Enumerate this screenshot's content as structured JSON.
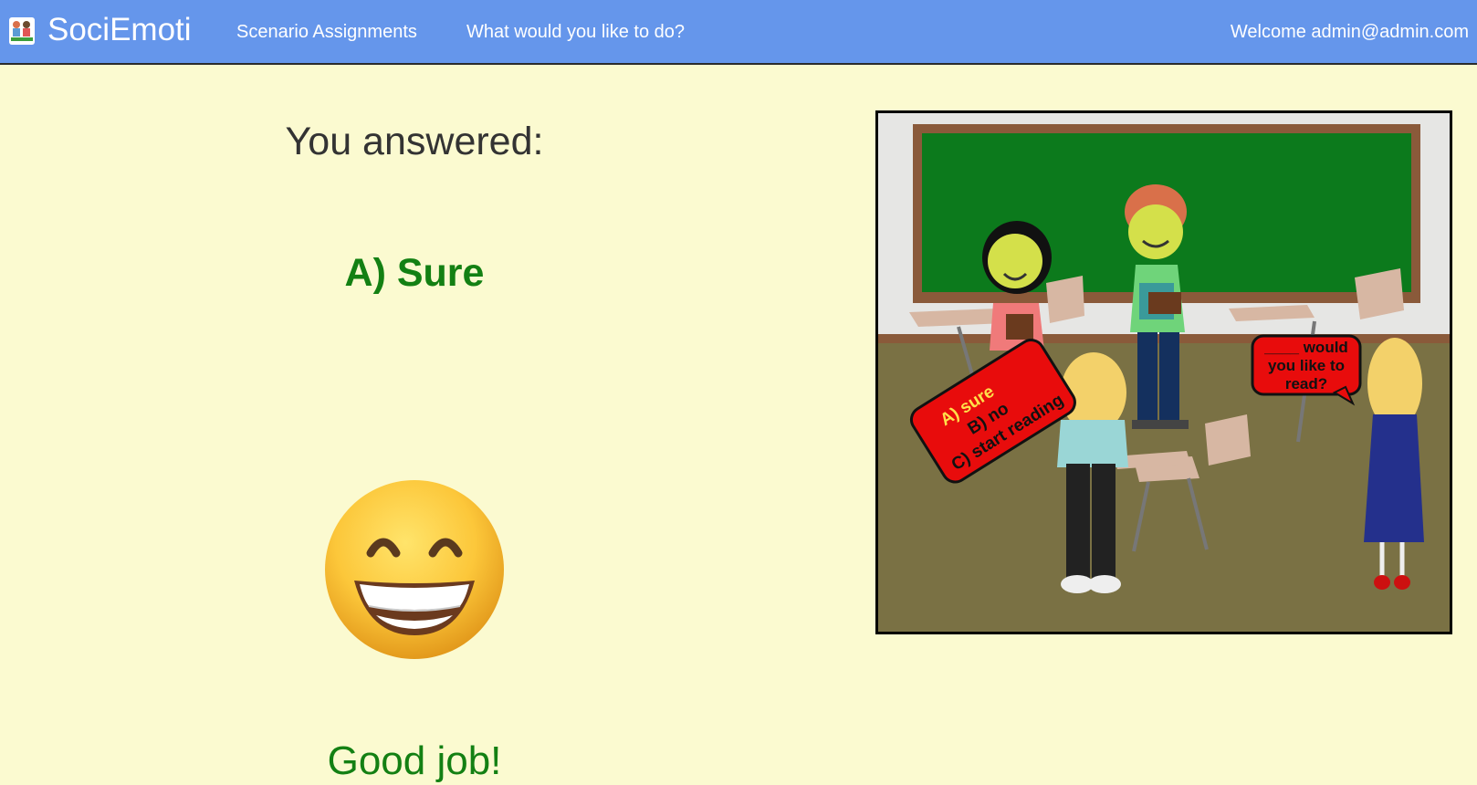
{
  "navbar": {
    "brand": "SociEmoti",
    "links": [
      "Scenario Assignments",
      "What would you like to do?"
    ],
    "welcome": "Welcome admin@admin.com",
    "background": "#6596eb"
  },
  "result": {
    "heading": "You answered:",
    "answer": "A) Sure",
    "emoji": "grinning-face-with-smiling-eyes-icon",
    "feedback": "Good job!",
    "answer_color": "#138013"
  },
  "scenario": {
    "speech_bubble_question": [
      "____ would",
      "you like to",
      "read?"
    ],
    "answer_sign_lines": [
      "A) sure",
      "B) no",
      "C) start reading"
    ]
  }
}
